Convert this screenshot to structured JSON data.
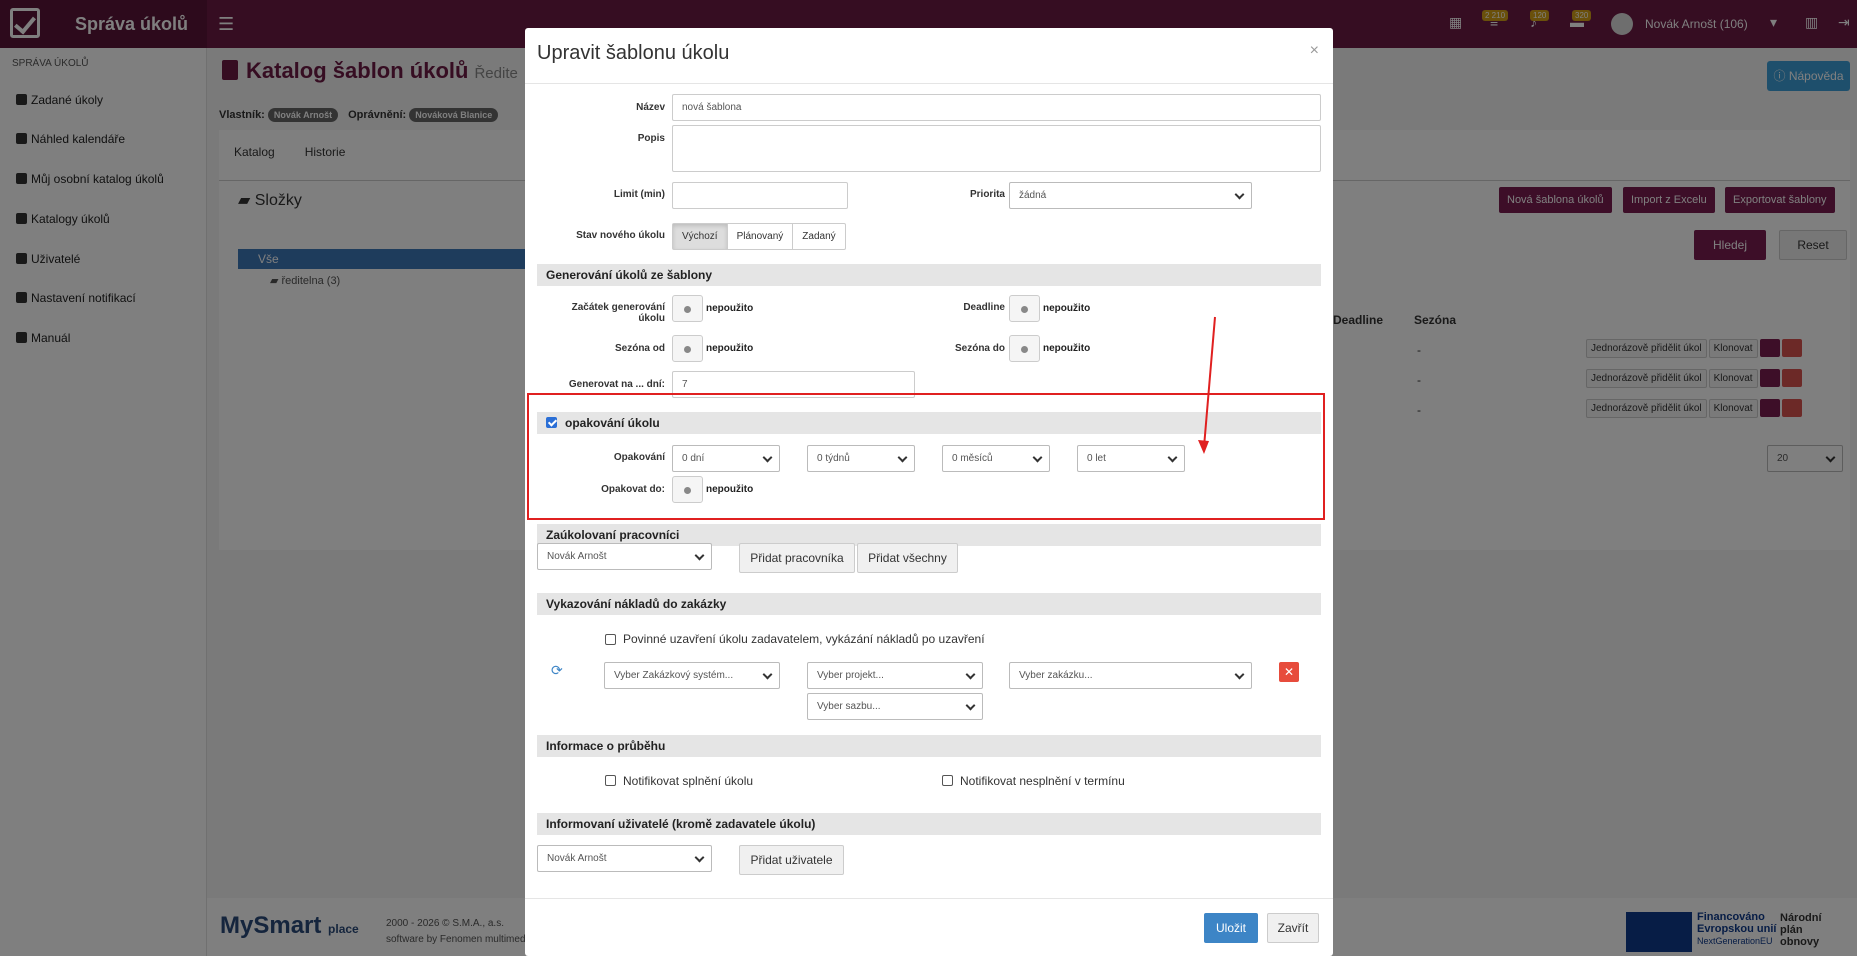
{
  "app": {
    "title": "Správa úkolů",
    "user": "Novák Arnošt (106)",
    "badges": [
      "2 210",
      "120",
      "320"
    ]
  },
  "sidebar": {
    "heading": "SPRÁVA ÚKOLŮ",
    "items": [
      {
        "label": "Zadané úkoly"
      },
      {
        "label": "Náhled kalendáře"
      },
      {
        "label": "Můj osobní katalog úkolů"
      },
      {
        "label": "Katalogy úkolů"
      },
      {
        "label": "Uživatelé"
      },
      {
        "label": "Nastavení notifikací"
      },
      {
        "label": "Manuál"
      }
    ]
  },
  "page": {
    "title": "Katalog šablon úkolů",
    "title_suffix": "Ředite",
    "owner_label": "Vlastník:",
    "owner": "Novák Arnošt",
    "perm_label": "Oprávnění:",
    "perm": "Nováková Blanice",
    "help": "Nápověda",
    "tabs": [
      "Katalog",
      "Historie"
    ],
    "folders": "Složky",
    "tree_all": "Vše",
    "tree_sub": "ředitelna",
    "tree_sub_count": "(3)",
    "buttons": {
      "new": "Nová šablona úkolů",
      "import": "Import z Excelu",
      "export": "Exportovat šablony",
      "search": "Hledej",
      "reset": "Reset"
    },
    "cols": {
      "deadline": "Deadline",
      "season": "Sezóna"
    },
    "rows": [
      {
        "season": "-",
        "assign": "Jednorázově přidělit úkol",
        "clone": "Klonovat"
      },
      {
        "season": "-",
        "assign": "Jednorázově přidělit úkol",
        "clone": "Klonovat"
      },
      {
        "season": "-",
        "assign": "Jednorázově přidělit úkol",
        "clone": "Klonovat"
      }
    ],
    "page_size": "20"
  },
  "footer": {
    "brand": "MySmart",
    "brand_sub": "place",
    "copy_prefix": "2000 - 2026 © ",
    "copy_company": "S.M.A., a.s.",
    "software_prefix": "software by ",
    "software_company": "Fenomen multimed",
    "eu_l1": "Financováno",
    "eu_l2": "Evropskou unií",
    "eu_l3": "NextGenerationEU",
    "npo_l1": "Národní",
    "npo_l2": "plán",
    "npo_l3": "obnovy"
  },
  "modal": {
    "title": "Upravit šablonu úkolu",
    "close": "×",
    "name_label": "Název",
    "name_value": "nová šablona",
    "desc_label": "Popis",
    "limit_label": "Limit (min)",
    "priority_label": "Priorita",
    "priority_value": "žádná",
    "state_label": "Stav nového úkolu",
    "state_options": [
      "Výchozí",
      "Plánovaný",
      "Zadaný"
    ],
    "sec_generate": "Generování úkolů ze šablony",
    "gen_start_label": "Začátek generování úkolu",
    "unused": "nepoužito",
    "deadline_label": "Deadline",
    "season_from_label": "Sezóna od",
    "season_to_label": "Sezóna do",
    "gen_days_label": "Generovat na ... dní:",
    "gen_days_value": "7",
    "repeat_section": "opakování úkolu",
    "repeat_label": "Opakování",
    "repeat_opts": [
      "0 dní",
      "0 týdnů",
      "0 měsíců",
      "0 let"
    ],
    "repeat_until_label": "Opakovat do:",
    "sec_workers": "Zaúkolovaní pracovníci",
    "worker_value": "Novák Arnošt",
    "add_worker": "Přidat pracovníka",
    "add_all": "Přidat všechny",
    "sec_costs": "Vykazování nákladů do zakázky",
    "mandatory_close": "Povinné uzavření úkolu zadavatelem, vykázání nákladů po uzavření",
    "sel_system": "Vyber Zakázkový systém...",
    "sel_project": "Vyber projekt...",
    "sel_order": "Vyber zakázku...",
    "sel_rate": "Vyber sazbu...",
    "sec_progress": "Informace o průběhu",
    "notify_done": "Notifikovat splnění úkolu",
    "notify_fail": "Notifikovat nesplnění v termínu",
    "sec_informed": "Informovaní uživatelé (kromě zadavatele úkolu)",
    "informed_value": "Novák Arnošt",
    "add_user": "Přidat uživatele",
    "save": "Uložit",
    "cancel": "Zavřít"
  }
}
